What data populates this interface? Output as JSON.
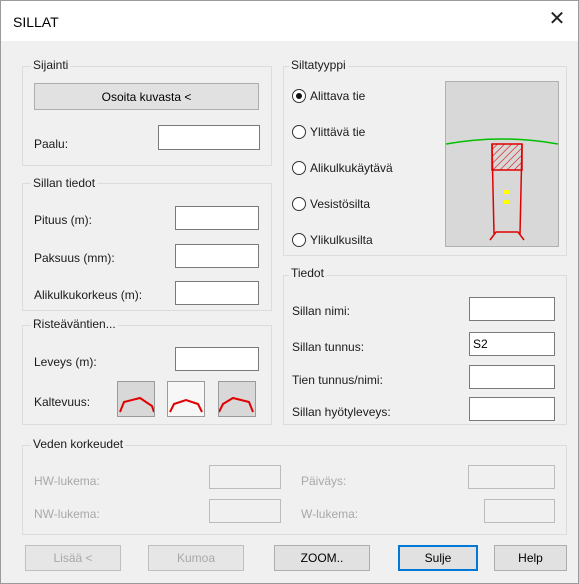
{
  "window": {
    "title": "SILLAT",
    "close_glyph": "✕"
  },
  "sijainti": {
    "label": "Sijainti",
    "button": "Osoita kuvasta <",
    "paalu_label": "Paalu:",
    "paalu_value": ""
  },
  "sillan_tiedot": {
    "label": "Sillan tiedot",
    "fields": [
      {
        "label": "Pituus (m):",
        "value": ""
      },
      {
        "label": "Paksuus (mm):",
        "value": ""
      },
      {
        "label": "Alikulkukorkeus (m):",
        "value": ""
      }
    ]
  },
  "risteavantien": {
    "label": "Risteäväntien...",
    "leveys_label": "Leveys (m):",
    "leveys_value": "",
    "kaltevuus_label": "Kaltevuus:"
  },
  "siltatyyppi": {
    "label": "Siltatyyppi",
    "options": [
      {
        "label": "Alittava tie",
        "checked": true
      },
      {
        "label": "Ylittävä tie",
        "checked": false
      },
      {
        "label": "Alikulkukäytävä",
        "checked": false
      },
      {
        "label": "Vesistösilta",
        "checked": false
      },
      {
        "label": "Ylikulkusilta",
        "checked": false
      }
    ]
  },
  "tiedot": {
    "label": "Tiedot",
    "fields": [
      {
        "label": "Sillan nimi:",
        "value": ""
      },
      {
        "label": "Sillan tunnus:",
        "value": "S2"
      },
      {
        "label": "Tien tunnus/nimi:",
        "value": ""
      },
      {
        "label": "Sillan hyötyleveys:",
        "value": ""
      }
    ]
  },
  "veden_korkeudet": {
    "label": "Veden korkeudet",
    "hw_label": "HW-lukema:",
    "hw_value": "",
    "nw_label": "NW-lukema:",
    "nw_value": "",
    "paivays_label": "Päiväys:",
    "paivays_value": "",
    "w_label": "W-lukema:",
    "w_value": ""
  },
  "buttons": {
    "lisaa": "Lisää <",
    "kumoa": "Kumoa",
    "zoom": "ZOOM..",
    "sulje": "Sulje",
    "help": "Help"
  },
  "colors": {
    "road_line": "#00c000",
    "bridge_outline": "#e00000",
    "marker": "#ffff00"
  }
}
